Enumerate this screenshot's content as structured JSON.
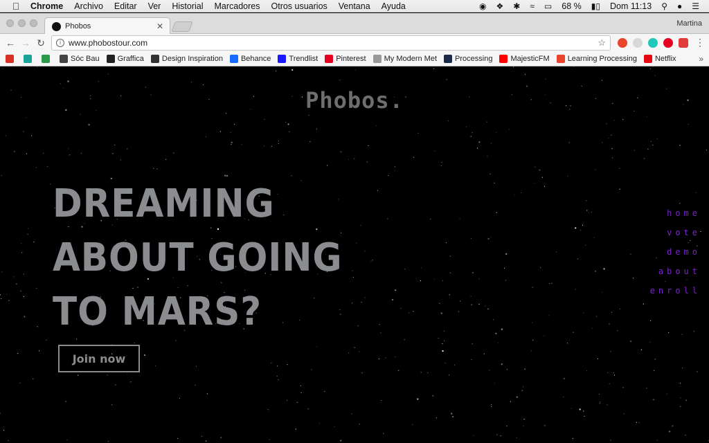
{
  "menubar": {
    "items": [
      "Chrome",
      "Archivo",
      "Editar",
      "Ver",
      "Historial",
      "Marcadores",
      "Otros usuarios",
      "Ventana",
      "Ayuda"
    ],
    "battery": "68 %",
    "clock": "Dom 11:13"
  },
  "tab": {
    "title": "Phobos"
  },
  "profile": "Martina",
  "address": {
    "url": "www.phobostour.com"
  },
  "bookmarks": [
    {
      "label": "",
      "icon": "gmail-icon",
      "color": "#d93025"
    },
    {
      "label": "",
      "icon": "m-icon",
      "color": "#1aa39a"
    },
    {
      "label": "",
      "icon": "drive-icon",
      "color": "#2b9a4b"
    },
    {
      "label": "Sóc Bau",
      "icon": "socbau-icon",
      "color": "#444444"
    },
    {
      "label": "Graffica",
      "icon": "graffica-icon",
      "color": "#222222"
    },
    {
      "label": "Design Inspiration",
      "icon": "d-icon",
      "color": "#333333"
    },
    {
      "label": "Behance",
      "icon": "behance-icon",
      "color": "#1769ff"
    },
    {
      "label": "Trendlist",
      "icon": "dot-icon",
      "color": "#1a1aff"
    },
    {
      "label": "Pinterest",
      "icon": "pinterest-icon",
      "color": "#e60023"
    },
    {
      "label": "My Modern Met",
      "icon": "mmm-icon",
      "color": "#999999"
    },
    {
      "label": "Processing",
      "icon": "p-icon",
      "color": "#1b2a4a"
    },
    {
      "label": "MajesticFM",
      "icon": "youtube-icon",
      "color": "#ff0000"
    },
    {
      "label": "Learning Processing",
      "icon": "lp-icon",
      "color": "#e8452c"
    },
    {
      "label": "Netflix",
      "icon": "netflix-icon",
      "color": "#e50914"
    }
  ],
  "page": {
    "logo": "Phobos.",
    "headline": [
      "DREAMING",
      "ABOUT GOING",
      "TO MARS?"
    ],
    "cta": "Join now",
    "nav": [
      "home",
      "vote",
      "demo",
      "about",
      "enroll"
    ],
    "accent": "#7a22c9",
    "text_gray": "#8b8c8f"
  }
}
